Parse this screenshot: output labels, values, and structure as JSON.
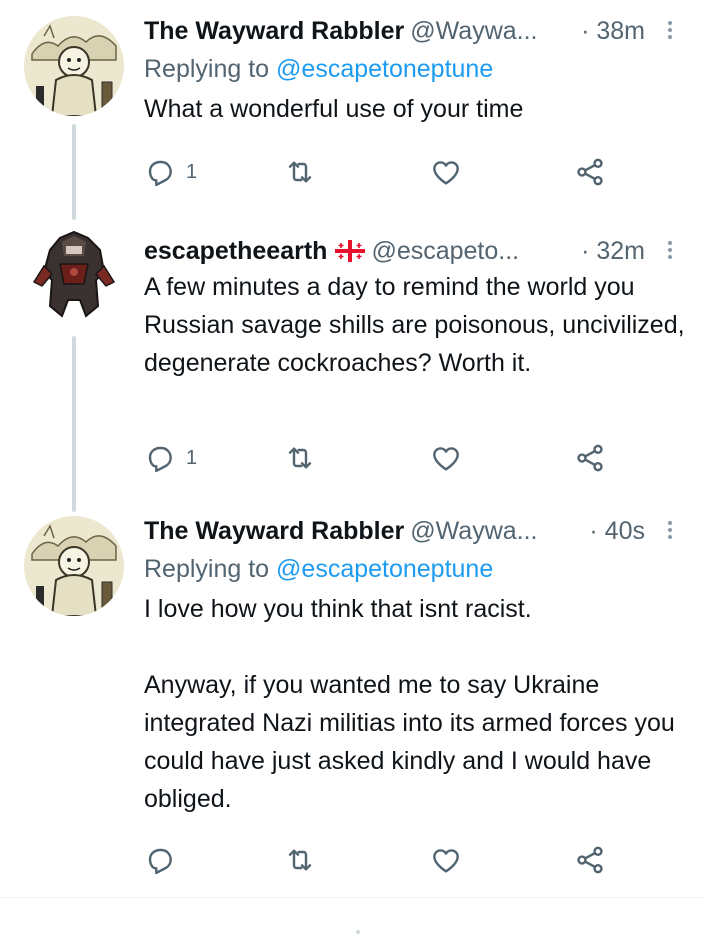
{
  "tweets": [
    {
      "name": "The Wayward Rabbler",
      "handle": "@Waywa...",
      "time": "· 38m",
      "reply_prefix": "Replying to ",
      "reply_to": "@escapetoneptune",
      "text": "What a wonderful use of your time",
      "reply_count": "1",
      "avatar": "cartoon-avatar"
    },
    {
      "name": "escapetheearth",
      "flag": "georgia-flag-icon",
      "handle": "@escapeto...",
      "time": "· 32m",
      "text": "A few minutes a day to remind the world you Russian savage shills are poisonous, uncivilized, degenerate cockroaches? Worth it.",
      "reply_count": "1",
      "avatar": "armored-figure-avatar"
    },
    {
      "name": "The Wayward Rabbler",
      "handle": "@Waywa...",
      "time": "· 40s",
      "reply_prefix": "Replying to ",
      "reply_to": "@escapetoneptune",
      "text": "I love how you think that isnt racist.\n\nAnyway, if you wanted me to say Ukraine integrated Nazi militias into its armed forces you could have just asked kindly and I would have obliged.",
      "reply_count": "",
      "avatar": "cartoon-avatar"
    }
  ],
  "icons": [
    "reply-icon",
    "retweet-icon",
    "like-icon",
    "share-icon",
    "more-icon"
  ],
  "colors": {
    "text": "#0f1419",
    "secondary": "#536471",
    "link": "#1d9bf0",
    "thread_line": "#cfd9de"
  }
}
